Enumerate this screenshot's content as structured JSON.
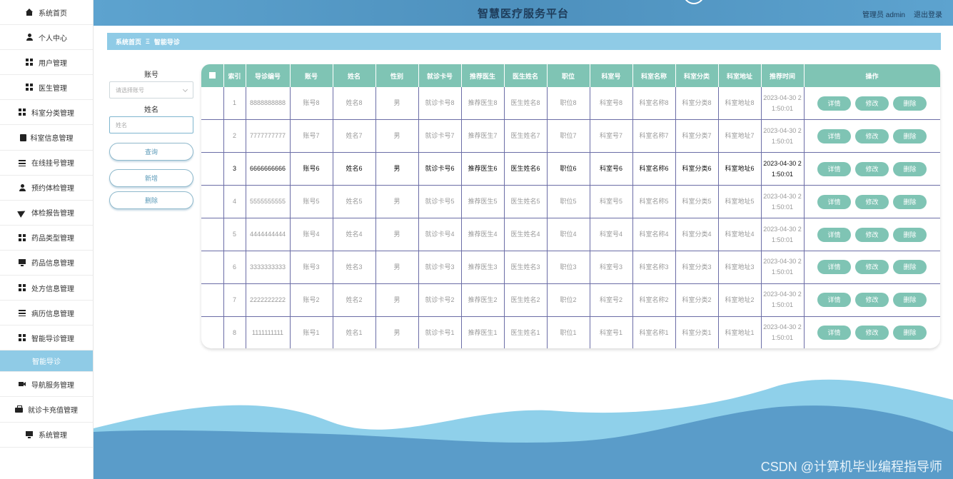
{
  "header": {
    "title": "智慧医疗服务平台",
    "admin_label": "管理员 admin",
    "logout": "退出登录"
  },
  "sidebar": {
    "items": [
      {
        "label": "系统首页",
        "icon": "home-icon"
      },
      {
        "label": "个人中心",
        "icon": "user-icon"
      },
      {
        "label": "用户管理",
        "icon": "grid-icon"
      },
      {
        "label": "医生管理",
        "icon": "grid-icon"
      },
      {
        "label": "科室分类管理",
        "icon": "grid-icon"
      },
      {
        "label": "科室信息管理",
        "icon": "clipboard-icon"
      },
      {
        "label": "在线挂号管理",
        "icon": "list-icon"
      },
      {
        "label": "预约体检管理",
        "icon": "user-icon"
      },
      {
        "label": "体检报告管理",
        "icon": "send-icon"
      },
      {
        "label": "药品类型管理",
        "icon": "grid-icon"
      },
      {
        "label": "药品信息管理",
        "icon": "monitor-icon"
      },
      {
        "label": "处方信息管理",
        "icon": "grid-icon"
      },
      {
        "label": "病历信息管理",
        "icon": "list-icon"
      },
      {
        "label": "智能导诊管理",
        "icon": "grid-icon"
      }
    ],
    "active_sub": "智能导诊",
    "items2": [
      {
        "label": "导航服务管理",
        "icon": "video-icon"
      },
      {
        "label": "就诊卡充值管理",
        "icon": "briefcase-icon"
      },
      {
        "label": "系统管理",
        "icon": "monitor-icon"
      }
    ]
  },
  "breadcrumb": {
    "home": "系统首页",
    "sep": "Ξ",
    "current": "智能导诊"
  },
  "search": {
    "account_label": "账号",
    "account_placeholder": "请选择账号",
    "name_label": "姓名",
    "name_placeholder": "姓名",
    "query": "查询",
    "add": "新增",
    "delete": "删除"
  },
  "table": {
    "headers": [
      "索引",
      "导诊编号",
      "账号",
      "姓名",
      "性别",
      "就诊卡号",
      "推荐医生",
      "医生姓名",
      "职位",
      "科室号",
      "科室名称",
      "科室分类",
      "科室地址",
      "推荐时间",
      "操作"
    ],
    "actions": {
      "detail": "详情",
      "edit": "修改",
      "delete": "删除"
    },
    "rows": [
      [
        "1",
        "8888888888",
        "账号8",
        "姓名8",
        "男",
        "就诊卡号8",
        "推荐医生8",
        "医生姓名8",
        "职位8",
        "科室号8",
        "科室名称8",
        "科室分类8",
        "科室地址8",
        "2023-04-30 21:50:01"
      ],
      [
        "2",
        "7777777777",
        "账号7",
        "姓名7",
        "男",
        "就诊卡号7",
        "推荐医生7",
        "医生姓名7",
        "职位7",
        "科室号7",
        "科室名称7",
        "科室分类7",
        "科室地址7",
        "2023-04-30 21:50:01"
      ],
      [
        "3",
        "6666666666",
        "账号6",
        "姓名6",
        "男",
        "就诊卡号6",
        "推荐医生6",
        "医生姓名6",
        "职位6",
        "科室号6",
        "科室名称6",
        "科室分类6",
        "科室地址6",
        "2023-04-30 21:50:01"
      ],
      [
        "4",
        "5555555555",
        "账号5",
        "姓名5",
        "男",
        "就诊卡号5",
        "推荐医生5",
        "医生姓名5",
        "职位5",
        "科室号5",
        "科室名称5",
        "科室分类5",
        "科室地址5",
        "2023-04-30 21:50:01"
      ],
      [
        "5",
        "4444444444",
        "账号4",
        "姓名4",
        "男",
        "就诊卡号4",
        "推荐医生4",
        "医生姓名4",
        "职位4",
        "科室号4",
        "科室名称4",
        "科室分类4",
        "科室地址4",
        "2023-04-30 21:50:01"
      ],
      [
        "6",
        "3333333333",
        "账号3",
        "姓名3",
        "男",
        "就诊卡号3",
        "推荐医生3",
        "医生姓名3",
        "职位3",
        "科室号3",
        "科室名称3",
        "科室分类3",
        "科室地址3",
        "2023-04-30 21:50:01"
      ],
      [
        "7",
        "2222222222",
        "账号2",
        "姓名2",
        "男",
        "就诊卡号2",
        "推荐医生2",
        "医生姓名2",
        "职位2",
        "科室号2",
        "科室名称2",
        "科室分类2",
        "科室地址2",
        "2023-04-30 21:50:01"
      ],
      [
        "8",
        "1111111111",
        "账号1",
        "姓名1",
        "男",
        "就诊卡号1",
        "推荐医生1",
        "医生姓名1",
        "职位1",
        "科室号1",
        "科室名称1",
        "科室分类1",
        "科室地址1",
        "2023-04-30 21:50:01"
      ]
    ],
    "highlighted_row": 3
  },
  "watermark": "CSDN @计算机毕业编程指导师",
  "colors": {
    "header": "#4d90bd",
    "accent": "#8fcbe6",
    "table_head": "#7fc4b4",
    "wave_light": "#8fd0ea",
    "wave_dark": "#5a9cc9"
  }
}
